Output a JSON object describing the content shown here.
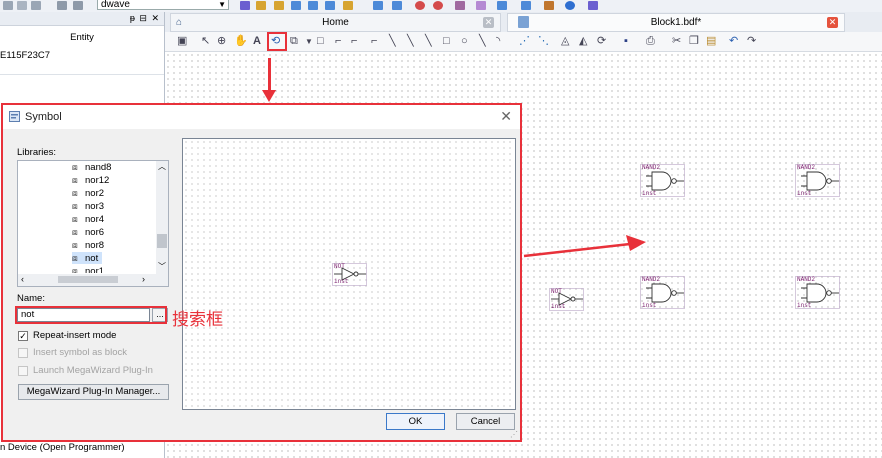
{
  "toolbar": {
    "project_value": "dwave"
  },
  "left_panel": {
    "column_header": "Entity",
    "entity_value": "E115F23C7",
    "bottom_text": "n Device (Open Programmer)",
    "controls": "ᵽ ⊟ ✕"
  },
  "tabs": {
    "home": "Home",
    "block": "Block1.bdf*"
  },
  "canvas": {
    "symbol_nand_title": "NAND2",
    "symbol_nand_inst": "inst",
    "symbol_not_title": "NOT",
    "symbol_not_inst": "inst"
  },
  "dialog": {
    "title": "Symbol",
    "libraries_label": "Libraries:",
    "library_items": [
      "nand8",
      "nor12",
      "nor2",
      "nor3",
      "nor4",
      "nor6",
      "nor8",
      "not",
      "nor1"
    ],
    "selected_item": "not",
    "name_label": "Name:",
    "name_value": "not",
    "browse_label": "...",
    "repeat_insert": "Repeat-insert mode",
    "insert_block": "Insert symbol as block",
    "launch_megawizard": "Launch MegaWizard Plug-In",
    "megawizard_manager": "MegaWizard Plug-In Manager...",
    "ok": "OK",
    "cancel": "Cancel",
    "preview_title": "NOT",
    "preview_inst": "inst"
  },
  "annotation": {
    "search_box": "搜索框"
  },
  "colors": {
    "accent_red": "#e8313a",
    "symbol_purple": "#7b1f6e"
  }
}
